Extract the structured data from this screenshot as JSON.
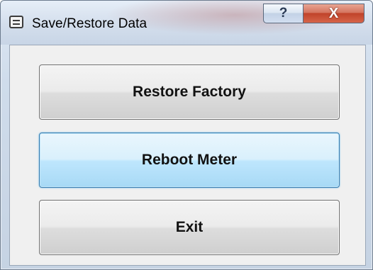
{
  "window": {
    "title": "Save/Restore Data",
    "caption_buttons": {
      "help_label": "?",
      "close_label": "X"
    }
  },
  "buttons": {
    "restore_factory": "Restore Factory",
    "reboot_meter": "Reboot Meter",
    "exit": "Exit"
  },
  "colors": {
    "focused_button_border": "#3c7fb1",
    "close_button_red": "#c0432a",
    "client_background": "#f0f0f0"
  },
  "icons": {
    "app_icon": "window-app-icon",
    "help_icon": "question-mark",
    "close_icon": "x-close"
  }
}
